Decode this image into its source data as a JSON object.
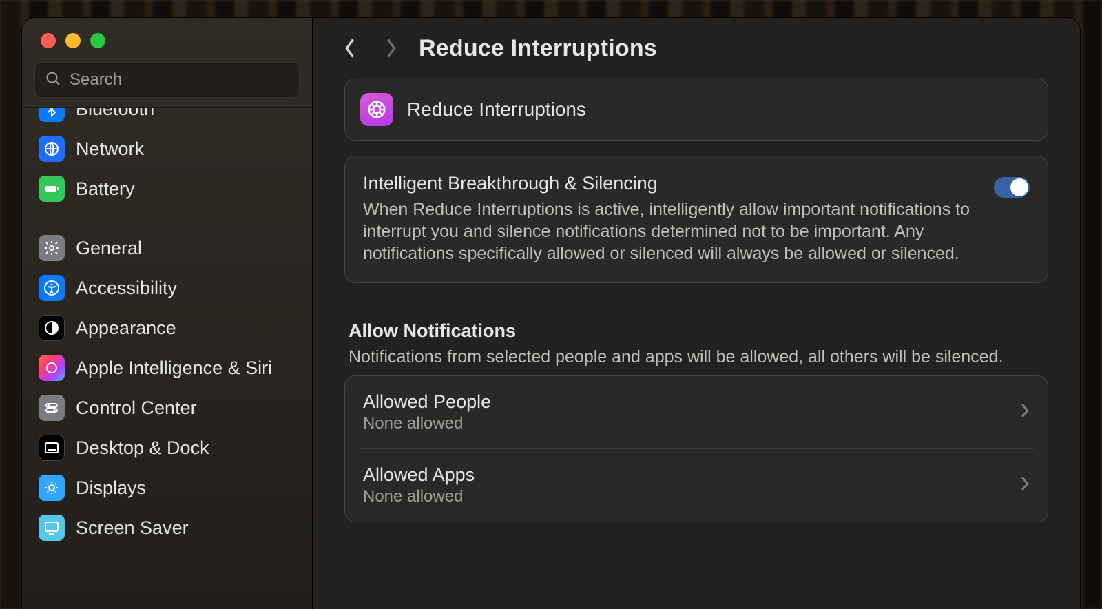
{
  "search": {
    "placeholder": "Search"
  },
  "header": {
    "title": "Reduce Interruptions"
  },
  "sidebar": {
    "items": [
      {
        "label": "Bluetooth"
      },
      {
        "label": "Network"
      },
      {
        "label": "Battery"
      },
      {
        "label": "General"
      },
      {
        "label": "Accessibility"
      },
      {
        "label": "Appearance"
      },
      {
        "label": "Apple Intelligence & Siri"
      },
      {
        "label": "Control Center"
      },
      {
        "label": "Desktop & Dock"
      },
      {
        "label": "Displays"
      },
      {
        "label": "Screen Saver"
      }
    ]
  },
  "focus": {
    "name": "Reduce Interruptions"
  },
  "toggle": {
    "title": "Intelligent Breakthrough & Silencing",
    "desc": "When Reduce Interruptions is active, intelligently allow important notifications to interrupt you and silence notifications determined not to be important. Any notifications specifically allowed or silenced will always be allowed or silenced.",
    "on": true
  },
  "allow_section": {
    "title": "Allow Notifications",
    "desc": "Notifications from selected people and apps will be allowed, all others will be silenced."
  },
  "allow_rows": [
    {
      "title": "Allowed People",
      "sub": "None allowed"
    },
    {
      "title": "Allowed Apps",
      "sub": "None allowed"
    }
  ]
}
